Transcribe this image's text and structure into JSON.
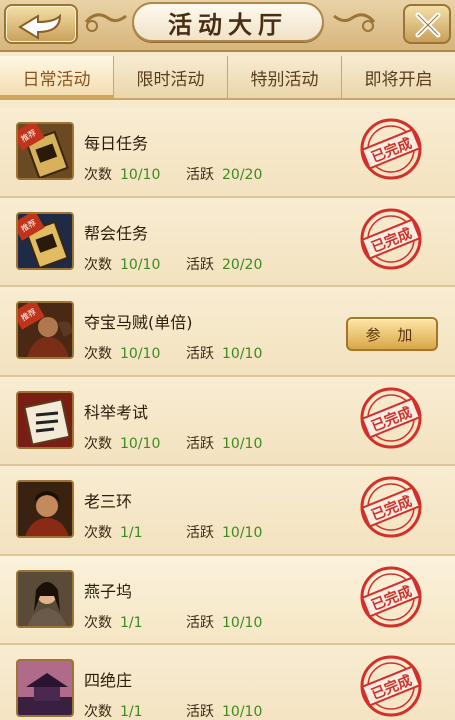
{
  "header": {
    "title": "活动大厅"
  },
  "tabs": [
    {
      "label": "日常活动",
      "active": true
    },
    {
      "label": "限时活动",
      "active": false
    },
    {
      "label": "特别活动",
      "active": false
    },
    {
      "label": "即将开启",
      "active": false
    }
  ],
  "labels": {
    "count": "次数",
    "activity": "活跃",
    "tag": "推荐",
    "stamp": "已完成",
    "join": "参 加"
  },
  "rows": [
    {
      "name": "每日任务",
      "count": "10/10",
      "activity": "20/20",
      "status": "done",
      "tag": true,
      "icon": "scroll-badge-icon"
    },
    {
      "name": "帮会任务",
      "count": "10/10",
      "activity": "20/20",
      "status": "done",
      "tag": true,
      "icon": "guild-badge-icon"
    },
    {
      "name": "夺宝马贼(单倍)",
      "count": "10/10",
      "activity": "10/10",
      "status": "join",
      "tag": true,
      "icon": "horse-bandit-icon"
    },
    {
      "name": "科举考试",
      "count": "10/10",
      "activity": "10/10",
      "status": "done",
      "tag": false,
      "icon": "exam-scroll-icon"
    },
    {
      "name": "老三环",
      "count": "1/1",
      "activity": "10/10",
      "status": "done",
      "tag": false,
      "icon": "warriors-icon"
    },
    {
      "name": "燕子坞",
      "count": "1/1",
      "activity": "10/10",
      "status": "done",
      "tag": false,
      "icon": "swordsman-icon"
    },
    {
      "name": "四绝庄",
      "count": "1/1",
      "activity": "10/10",
      "status": "done",
      "tag": false,
      "icon": "pavilion-icon"
    }
  ],
  "colors": {
    "value_green": "#3e8a1e",
    "stamp_red": "#d3302a",
    "background": "#f6e9cc"
  }
}
